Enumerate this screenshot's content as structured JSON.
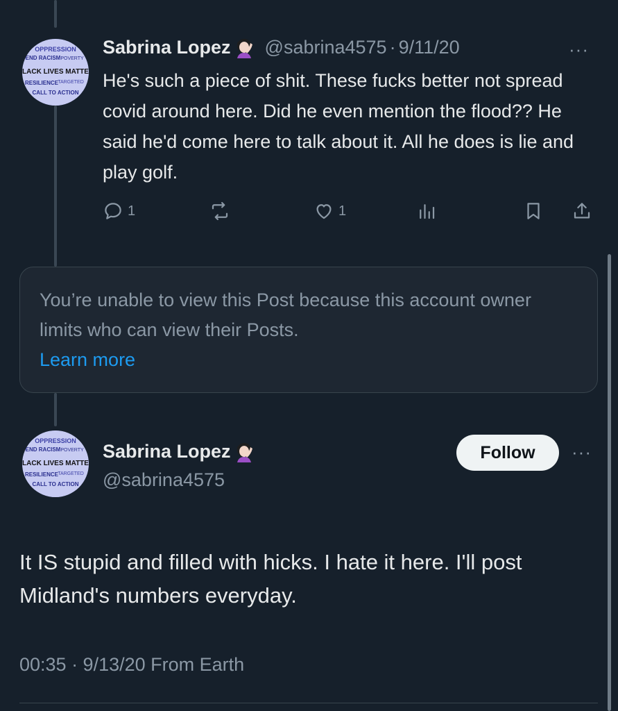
{
  "reply_tweet": {
    "display_name": "Sabrina Lopez",
    "emoji": "woman-facepalming-emoji",
    "handle": "@sabrina4575",
    "separator": "·",
    "date": "9/11/20",
    "more": "···",
    "text": "He's such a piece of shit. These fucks better not spread covid around here. Did he even mention the flood?? He said he'd come here to talk about it. All he does is lie and play golf.",
    "actions": {
      "reply_count": "1",
      "like_count": "1"
    }
  },
  "restricted_post": {
    "message": "You’re unable to view this Post because this account owner limits who can view their Posts.",
    "link": "Learn more"
  },
  "main_tweet": {
    "display_name": "Sabrina Lopez",
    "handle": "@sabrina4575",
    "follow_label": "Follow",
    "more": "···",
    "text": "It IS stupid and filled with hicks. I hate it here. I'll post Midland's numbers everyday.",
    "timestamp": "00:35 · 9/13/20 From Earth"
  },
  "avatar_words": [
    "OPPRESSION",
    "END RACISM",
    "POVERTY",
    "BLACK LIVES MATTER",
    "RESILIENCE",
    "TARGETED",
    "CALL TO ACTION"
  ],
  "colors": {
    "background": "#16202b",
    "text": "#e7e9ea",
    "muted": "#8b98a5",
    "link": "#1d9bf0"
  }
}
